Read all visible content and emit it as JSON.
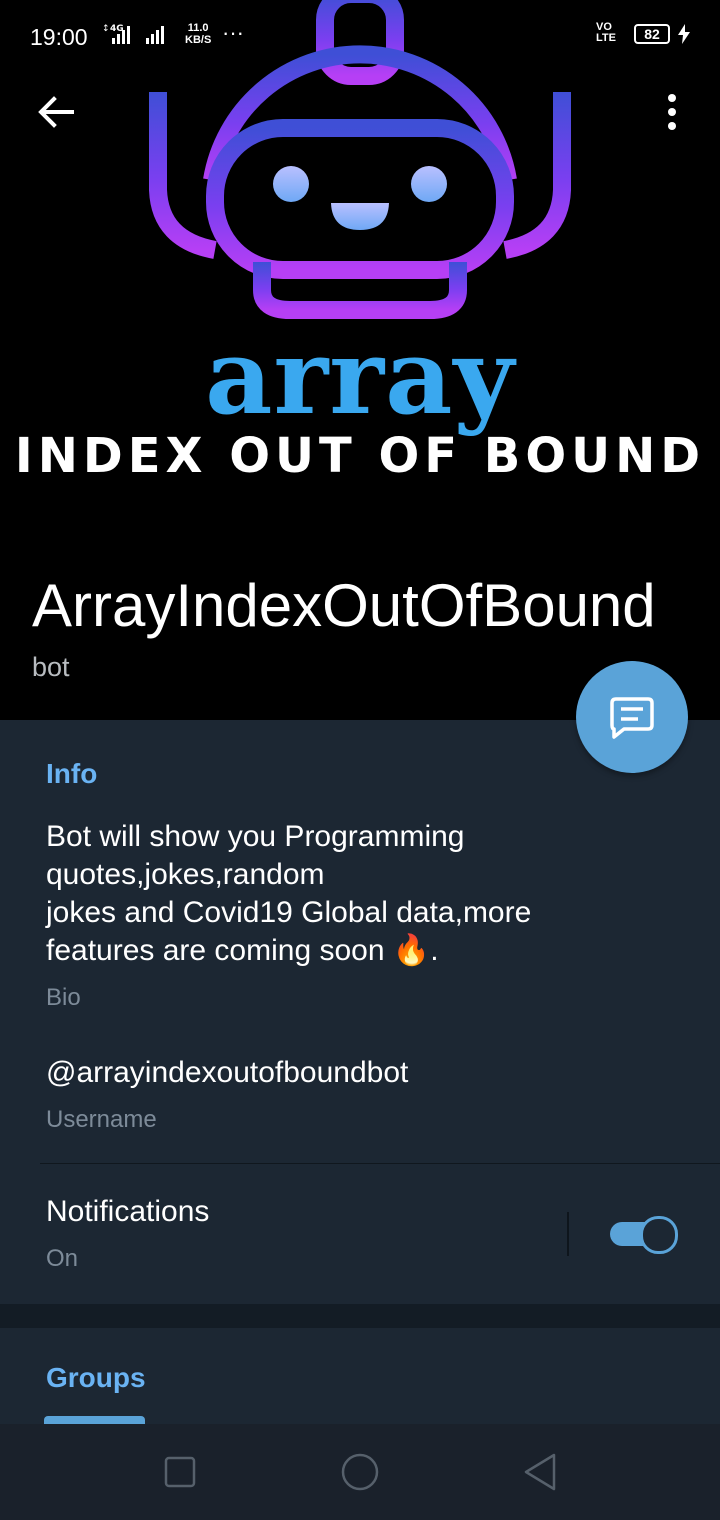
{
  "status_bar": {
    "time": "19:00",
    "network": "4G",
    "speed_value": "11.0",
    "speed_unit": "KB/S",
    "overflow": "···",
    "volte": "VO LTE",
    "battery": "82"
  },
  "header": {
    "logo_word": "array",
    "logo_tagline": "INDEX OUT OF BOUND",
    "name": "ArrayIndexOutOfBound",
    "type": "bot"
  },
  "info": {
    "title": "Info",
    "bio_lines": [
      "Bot will show you Programming",
      "quotes,jokes,random",
      "jokes and Covid19 Global data,more",
      "features are coming soon 🔥."
    ],
    "bio_label": "Bio",
    "username": "@arrayindexoutofboundbot",
    "username_label": "Username",
    "notifications_label": "Notifications",
    "notifications_value": "On",
    "notifications_enabled": true
  },
  "groups": {
    "title": "Groups"
  },
  "colors": {
    "accent": "#5aa3d8",
    "section_title": "#6ab3f3",
    "logo_blue": "#3aa8ef",
    "logo_purple": "#8b3ff0",
    "background": "#1c2733"
  },
  "icons": {
    "back": "arrow-left-icon",
    "menu": "more-vertical-icon",
    "fab": "message-icon",
    "nav_recent": "square-icon",
    "nav_home": "circle-icon",
    "nav_back": "triangle-back-icon"
  }
}
